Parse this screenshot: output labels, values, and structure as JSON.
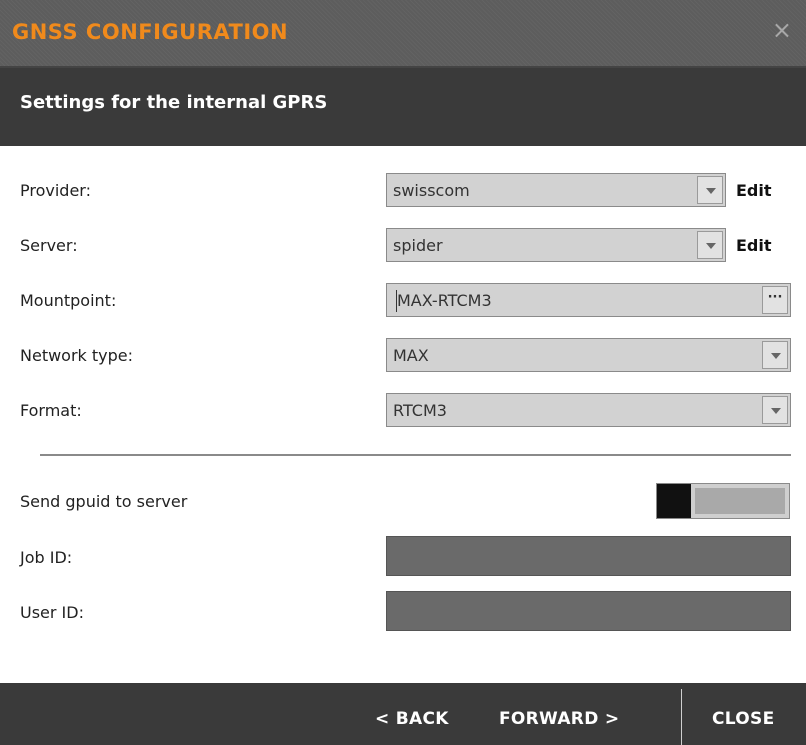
{
  "window": {
    "title": "GNSS CONFIGURATION",
    "close_glyph": "×",
    "accent_color": "#f08a1c"
  },
  "header": {
    "subtitle": "Settings for the internal GPRS"
  },
  "form": {
    "provider": {
      "label": "Provider:",
      "value": "swisscom",
      "edit_label": "Edit"
    },
    "server": {
      "label": "Server:",
      "value": "spider",
      "edit_label": "Edit"
    },
    "mountpoint": {
      "label": "Mountpoint:",
      "value": "MAX-RTCM3",
      "browse_glyph": "···"
    },
    "network_type": {
      "label": "Network type:",
      "value": "MAX"
    },
    "format": {
      "label": "Format:",
      "value": "RTCM3"
    },
    "send_gpuid": {
      "label": "Send gpuid to server",
      "enabled": false
    },
    "job_id": {
      "label": "Job ID:",
      "value": ""
    },
    "user_id": {
      "label": "User ID:",
      "value": ""
    }
  },
  "footer": {
    "back_label": "< BACK",
    "forward_label": "FORWARD >",
    "close_label": "CLOSE"
  }
}
